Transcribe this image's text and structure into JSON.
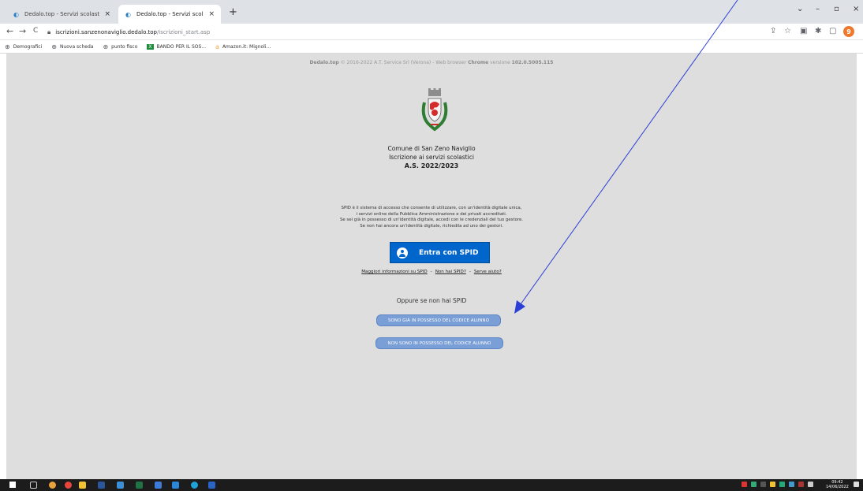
{
  "browser": {
    "tabs": [
      {
        "title": "Dedalo.top - Servizi scolastici",
        "close": "×"
      },
      {
        "title": "Dedalo.top - Servizi scolastici",
        "close": "×"
      }
    ],
    "new_tab": "+",
    "window_controls": {
      "dropdown": "⌄",
      "minimize": "–",
      "maximize": "▫",
      "close": "×"
    },
    "nav": {
      "back": "←",
      "forward": "→",
      "reload": "C"
    },
    "url_host": "iscrizioni.sanzenonaviglio.dedalo.top",
    "url_path": "/iscrizioni_start.asp",
    "profile_initial": "9",
    "bookmarks": [
      {
        "label": "Demografici",
        "icon": "globe-icon"
      },
      {
        "label": "Nuova scheda",
        "icon": "globe-icon"
      },
      {
        "label": "punto fisco",
        "icon": "globe-icon"
      },
      {
        "label": "BANDO PER IL SOS...",
        "icon": "excel-icon"
      },
      {
        "label": "Amazon.it: Mignoli...",
        "icon": "amazon-icon"
      }
    ]
  },
  "page": {
    "footer_brand": "Dedalo.top",
    "footer_text": " © 2016-2022 A.T. Service Srl (Verona)  -  Web browser ",
    "footer_browser": "Chrome",
    "footer_version_label": " versione ",
    "footer_version": "102.0.5005.115",
    "municipality": "Comune di San Zeno Naviglio",
    "service": "Iscrizione ai servizi scolastici",
    "school_year": "A.S. 2022/2023",
    "spid_desc": [
      "SPID è il sistema di accesso che consente di utilizzare, con un'identità digitale unica,",
      "i servizi online della Pubblica Amministrazione e dei privati accreditati.",
      "Se sei già in possesso di un'identità digitale, accedi con le credenziali del tuo gestore.",
      "Se non hai ancora un'identità digitale, richiedila ad uno dei gestori."
    ],
    "spid_button": "Entra con SPID",
    "spid_links": [
      "Maggiori informazioni su SPID",
      "Non hai SPID?",
      "Serve aiuto?"
    ],
    "link_separator": "-",
    "or_text": "Oppure se non hai SPID",
    "code_yes_button": "SONO GIÀ IN POSSESSO DEL CODICE ALUNNO",
    "code_no_button": "NON SONO IN POSSESSO DEL CODICE ALUNNO"
  },
  "taskbar": {
    "time": "09:42",
    "date": "14/06/2022"
  },
  "colors": {
    "spid_blue": "#0066cc",
    "code_button": "#7a9ed6",
    "annotation_arrow": "#2b3fd6",
    "page_bg": "#dedede"
  }
}
